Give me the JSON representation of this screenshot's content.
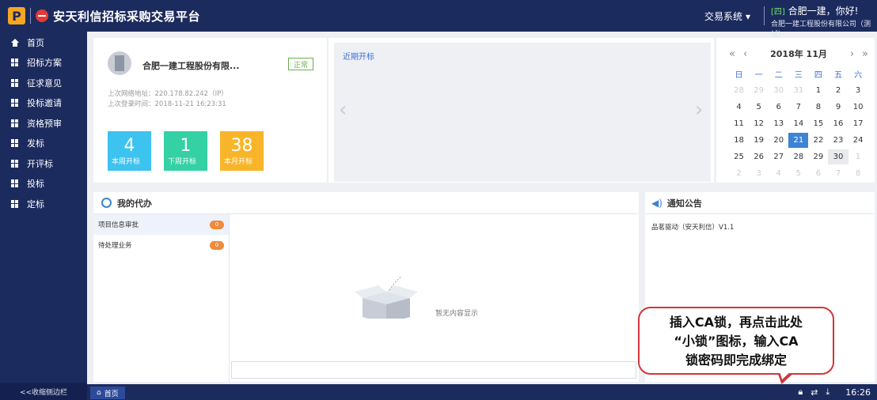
{
  "header": {
    "logo_letter": "P",
    "app_title": "安天利信招标采购交易平台",
    "system_menu": "交易系统",
    "user_tag": "[四]",
    "greeting": "合肥一建，你好!",
    "org": "合肥一建工程股份有限公司（测试）"
  },
  "sidebar": {
    "items": [
      {
        "label": "首页"
      },
      {
        "label": "招标方案"
      },
      {
        "label": "征求意见"
      },
      {
        "label": "投标邀请"
      },
      {
        "label": "资格预审"
      },
      {
        "label": "发标"
      },
      {
        "label": "开评标"
      },
      {
        "label": "投标"
      },
      {
        "label": "定标"
      }
    ],
    "collapse_label": "<<收缩侧边栏"
  },
  "user_card": {
    "company": "合肥一建工程股份有限...",
    "status": "正常",
    "last_ip": "上次网络地址：220.178.82.242（IP）",
    "last_login": "上次登录时间：2018-11-21 16:23:31",
    "tiles": [
      {
        "num": "4",
        "label": "本周开标",
        "color": "#3cc3ef"
      },
      {
        "num": "1",
        "label": "下周开标",
        "color": "#33d1a3"
      },
      {
        "num": "38",
        "label": "本月开标",
        "color": "#f9b529"
      }
    ]
  },
  "carousel": {
    "title": "近期开标"
  },
  "calendar": {
    "title": "2018年 11月",
    "weekdays": [
      "日",
      "一",
      "二",
      "三",
      "四",
      "五",
      "六"
    ],
    "days": [
      "28",
      "29",
      "30",
      "31",
      "1",
      "2",
      "3",
      "4",
      "5",
      "6",
      "7",
      "8",
      "9",
      "10",
      "11",
      "12",
      "13",
      "14",
      "15",
      "16",
      "17",
      "18",
      "19",
      "20",
      "21",
      "22",
      "23",
      "24",
      "25",
      "26",
      "27",
      "28",
      "29",
      "30",
      "1",
      "2",
      "3",
      "4",
      "5",
      "6",
      "7",
      "8"
    ],
    "today": "21"
  },
  "todo": {
    "title": "我的代办",
    "items": [
      {
        "label": "项目信息审批",
        "count": "0"
      },
      {
        "label": "待处理业务",
        "count": "0"
      }
    ],
    "empty_text": "暂无内容显示"
  },
  "notice": {
    "title": "通知公告",
    "items": [
      "品茗驱动（安天利信）V1.1"
    ]
  },
  "callout": {
    "text": "插入CA锁，再点击此处\n“小锁”图标，输入CA\n锁密码即完成绑定"
  },
  "statusbar": {
    "home_tab": "首页",
    "time": "16:26"
  }
}
